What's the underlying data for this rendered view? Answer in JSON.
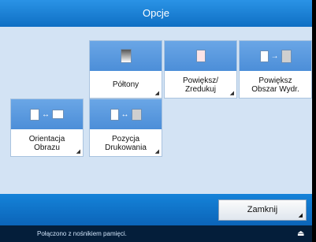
{
  "window": {
    "title": "Opcje"
  },
  "options": [
    {
      "label": "Półtony",
      "icon": "gradient-document-icon"
    },
    {
      "label": "Powiększ/\nZredukuj",
      "icon": "zoom-document-icon"
    },
    {
      "label": "Powiększ\nObszar Wydr.",
      "icon": "enlarge-print-area-icon"
    },
    {
      "label": "Orientacja\nObrazu",
      "icon": "image-orientation-icon"
    },
    {
      "label": "Pozycja\nDrukowania",
      "icon": "print-position-icon"
    }
  ],
  "buttons": {
    "close_label": "Zamknij"
  },
  "status": {
    "text": "Połączono z nośnikiem pamięci."
  },
  "colors": {
    "title_bar": "#0f6fc4",
    "tile_image": "#4c8ed8",
    "background": "#d3e3f4",
    "status_bar": "#041e3a"
  }
}
